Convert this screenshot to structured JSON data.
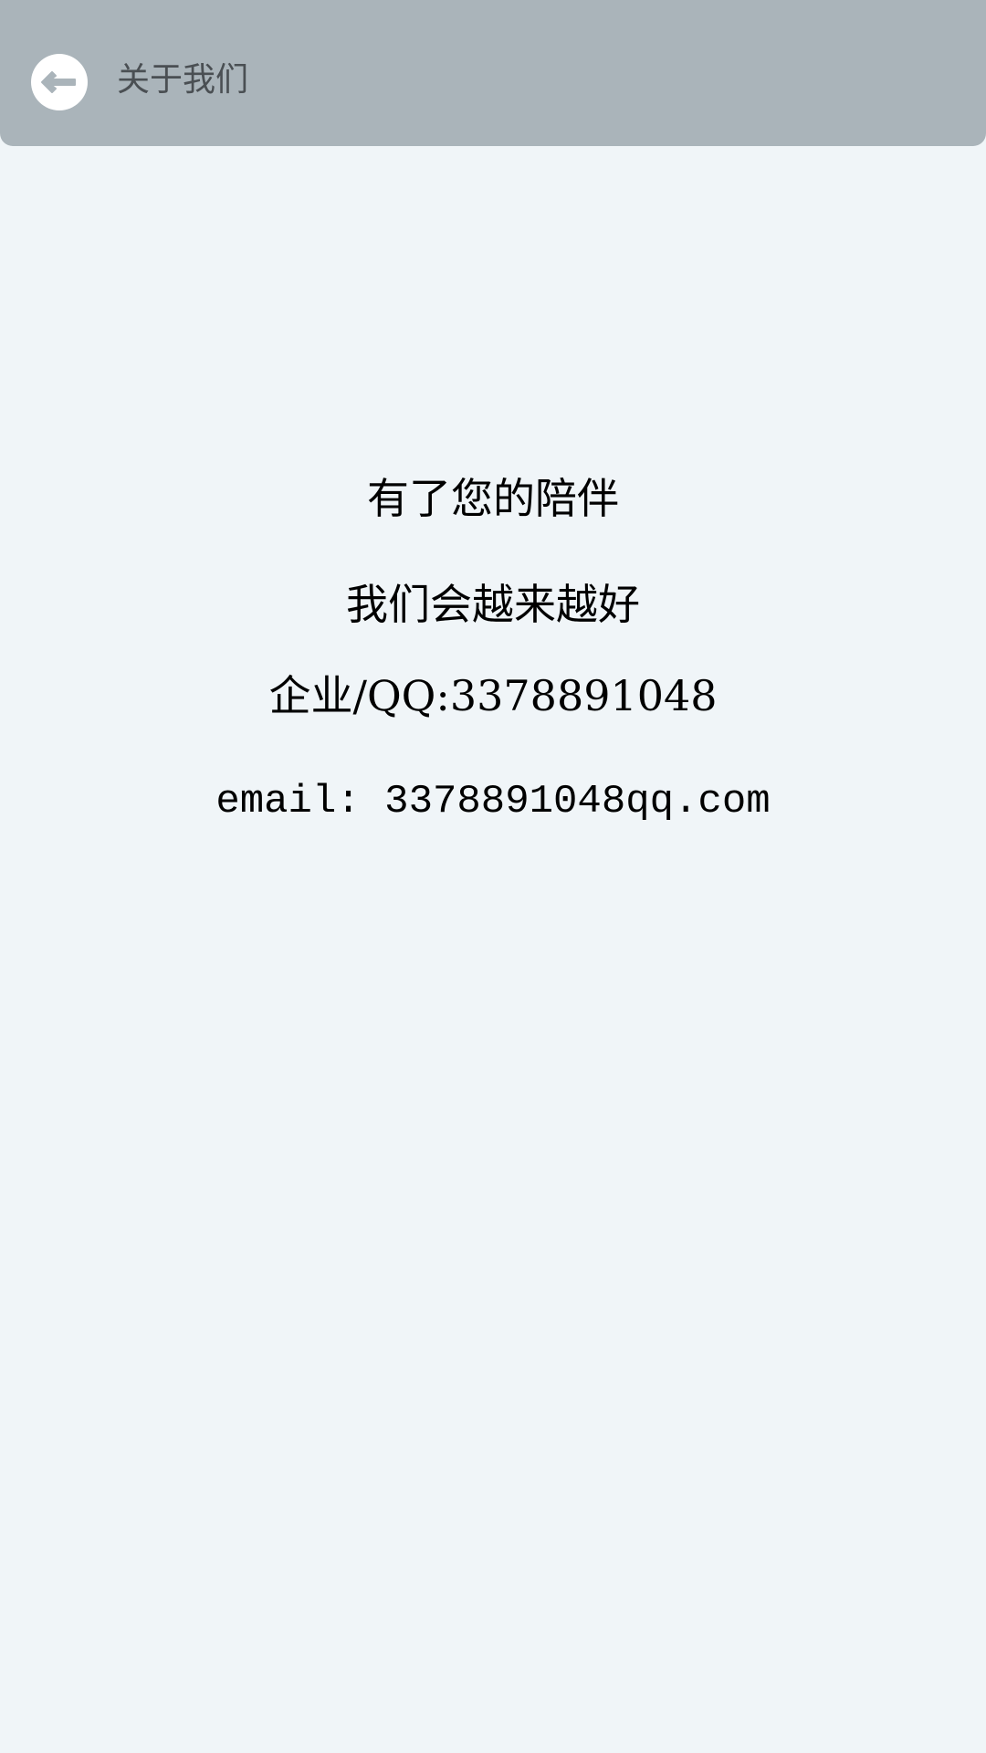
{
  "header": {
    "title": "关于我们",
    "back_icon": "arrow-left-circle-icon"
  },
  "about": {
    "line1": "有了您的陪伴",
    "line2": "我们会越来越好",
    "qq_prefix": "企业",
    "qq_text": "/QQ:3378891048",
    "email": "email: 3378891048qq.com"
  },
  "colors": {
    "header_bg": "#aab4ba",
    "page_bg": "#f0f5f8",
    "title_text": "#4a4f53",
    "body_text": "#000000"
  }
}
